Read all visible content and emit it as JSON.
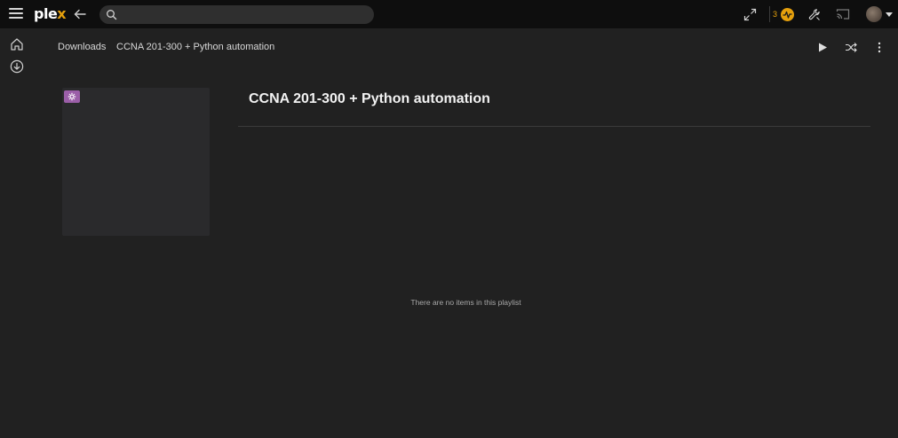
{
  "app": {
    "logo_main": "ple",
    "logo_accent": "x"
  },
  "search": {
    "placeholder": "",
    "value": ""
  },
  "header": {
    "activity_count": "3"
  },
  "sidebar": {
    "items": [
      {
        "icon": "home-icon"
      },
      {
        "icon": "download-icon"
      }
    ]
  },
  "breadcrumb": {
    "items": [
      "Downloads",
      "CCNA 201-300 + Python automation"
    ]
  },
  "playlist": {
    "title": "CCNA 201-300 + Python automation",
    "empty_message": "There are no items in this playlist"
  },
  "colors": {
    "accent": "#e5a00d",
    "badge": "#9b5ea8",
    "background": "#212121",
    "topbar": "#0e0e0e"
  }
}
